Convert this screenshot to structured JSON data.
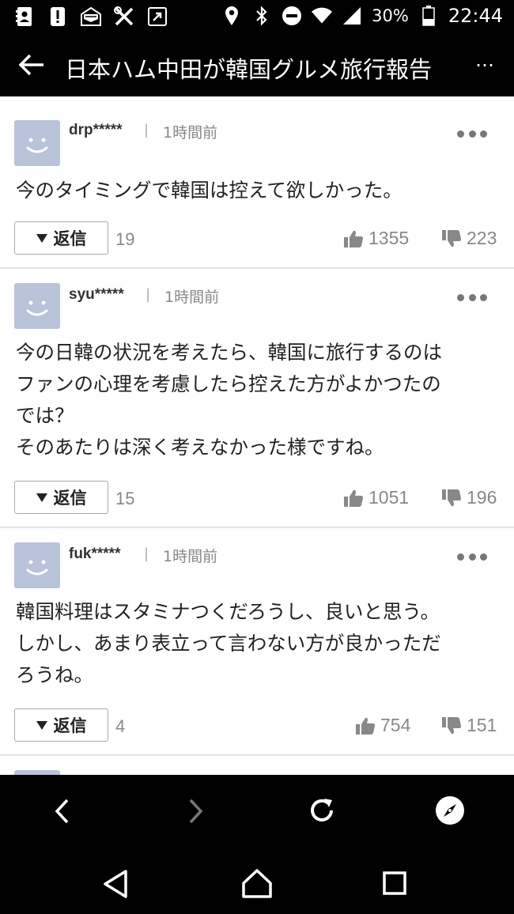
{
  "status": {
    "battery_percent": "30%",
    "time": "22:44",
    "icons_left": [
      "contacts-icon",
      "alert-icon",
      "mail-icon",
      "tools-icon",
      "share-icon"
    ],
    "icons_right": [
      "location-icon",
      "bluetooth-icon",
      "do-not-disturb-icon",
      "wifi-icon",
      "signal-icon",
      "battery-icon"
    ]
  },
  "header": {
    "title": "日本ハム中田が韓国グルメ旅行報告",
    "more": "…"
  },
  "comments": [
    {
      "user": "drp*****",
      "sep": "|",
      "time": "1時間前",
      "text": "今のタイミングで韓国は控えて欲しかった。",
      "reply_label": "返信",
      "reply_count": "19",
      "likes": "1355",
      "dislikes": "223"
    },
    {
      "user": "syu*****",
      "sep": "|",
      "time": "1時間前",
      "text": "今の日韓の状況を考えたら、韓国に旅行するのは\nファンの心理を考慮したら控えた方がよかつたの\nでは？\nそのあたりは深く考えなかった様ですね。",
      "reply_label": "返信",
      "reply_count": "15",
      "likes": "1051",
      "dislikes": "196"
    },
    {
      "user": "fuk*****",
      "sep": "|",
      "time": "1時間前",
      "text": "韓国料理はスタミナつくだろうし、良いと思う。\nしかし、あまり表立って言わない方が良かっただ\nろうね。",
      "reply_label": "返信",
      "reply_count": "4",
      "likes": "754",
      "dislikes": "151"
    }
  ],
  "colors": {
    "avatar_bg": "#b9c3da",
    "icon_gray": "#888888",
    "bar_bg": "#000000"
  }
}
